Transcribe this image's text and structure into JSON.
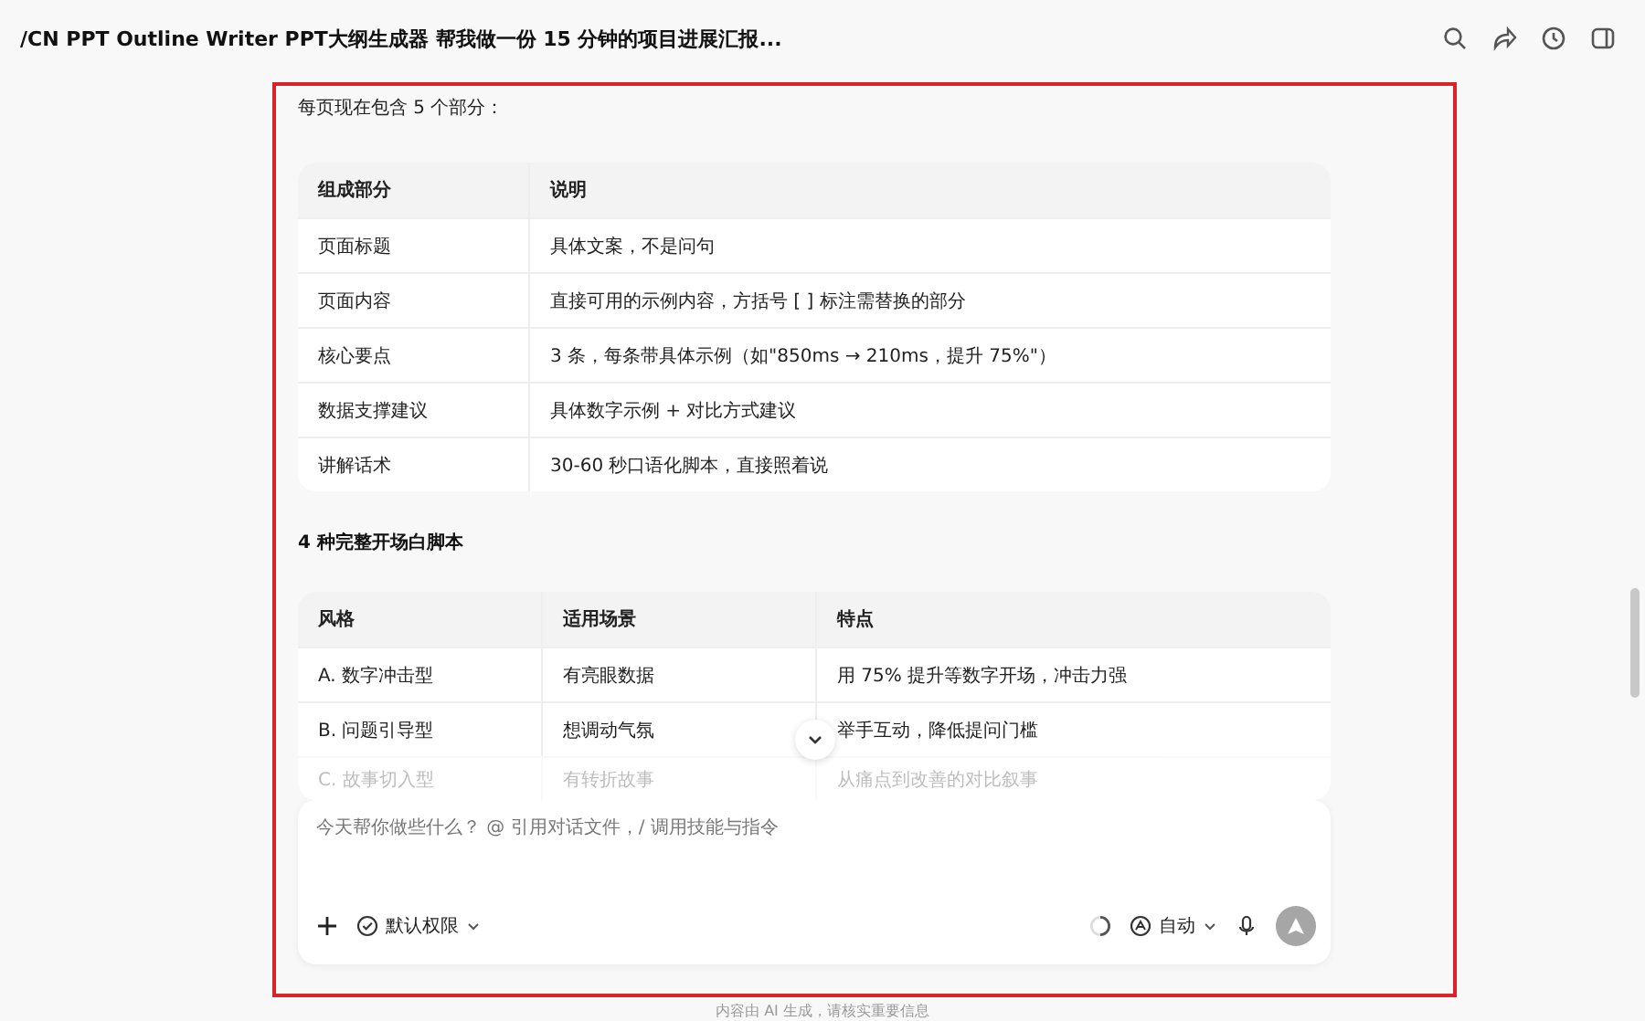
{
  "header": {
    "title": "/CN PPT Outline Writer PPT大纲生成器 帮我做一份 15 分钟的项目进展汇报..."
  },
  "intro": "每页现在包含 5 个部分：",
  "table_1": {
    "columns": [
      "组成部分",
      "说明"
    ],
    "rows": [
      [
        "页面标题",
        "具体文案，不是问句"
      ],
      [
        "页面内容",
        "直接可用的示例内容，方括号 [ ] 标注需替换的部分"
      ],
      [
        "核心要点",
        "3 条，每条带具体示例（如\"850ms → 210ms，提升 75%\"）"
      ],
      [
        "数据支撑建议",
        "具体数字示例 + 对比方式建议"
      ],
      [
        "讲解话术",
        "30-60 秒口语化脚本，直接照着说"
      ]
    ]
  },
  "heading": "4 种完整开场白脚本",
  "table_2": {
    "columns": [
      "风格",
      "适用场景",
      "特点"
    ],
    "rows": [
      {
        "cells": [
          "A. 数字冲击型",
          "有亮眼数据",
          "用 75% 提升等数字开场，冲击力强"
        ],
        "faded": false
      },
      {
        "cells": [
          "B. 问题引导型",
          "想调动气氛",
          "举手互动，降低提问门槛"
        ],
        "faded": false
      },
      {
        "cells": [
          "C. 故事切入型",
          "有转折故事",
          "从痛点到改善的对比叙事"
        ],
        "faded": true
      }
    ]
  },
  "composer": {
    "placeholder": "今天帮你做些什么？ @ 引用对话文件，/ 调用技能与指令",
    "permission": "默认权限",
    "mode": "自动",
    "send_disabled": true
  },
  "footer": "内容由 AI 生成，请核实重要信息"
}
